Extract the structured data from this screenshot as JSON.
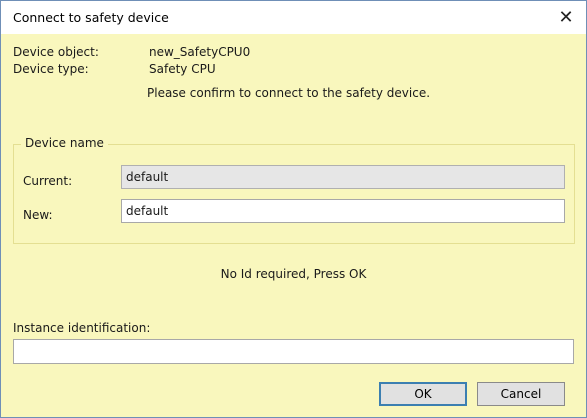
{
  "window": {
    "title": "Connect to safety device",
    "close_symbol": "✕"
  },
  "device_info": {
    "object_label": "Device object:",
    "object_value": "new_SafetyCPU0",
    "type_label": "Device type:",
    "type_value": "Safety CPU"
  },
  "confirm_message": "Please confirm to connect to the safety device.",
  "device_name_group": {
    "legend": "Device name",
    "current_label": "Current:",
    "current_value": "default",
    "new_label": "New:",
    "new_value": "default"
  },
  "status_message": "No Id required, Press OK",
  "instance": {
    "label": "Instance identification:",
    "value": ""
  },
  "buttons": {
    "ok": "OK",
    "cancel": "Cancel"
  }
}
